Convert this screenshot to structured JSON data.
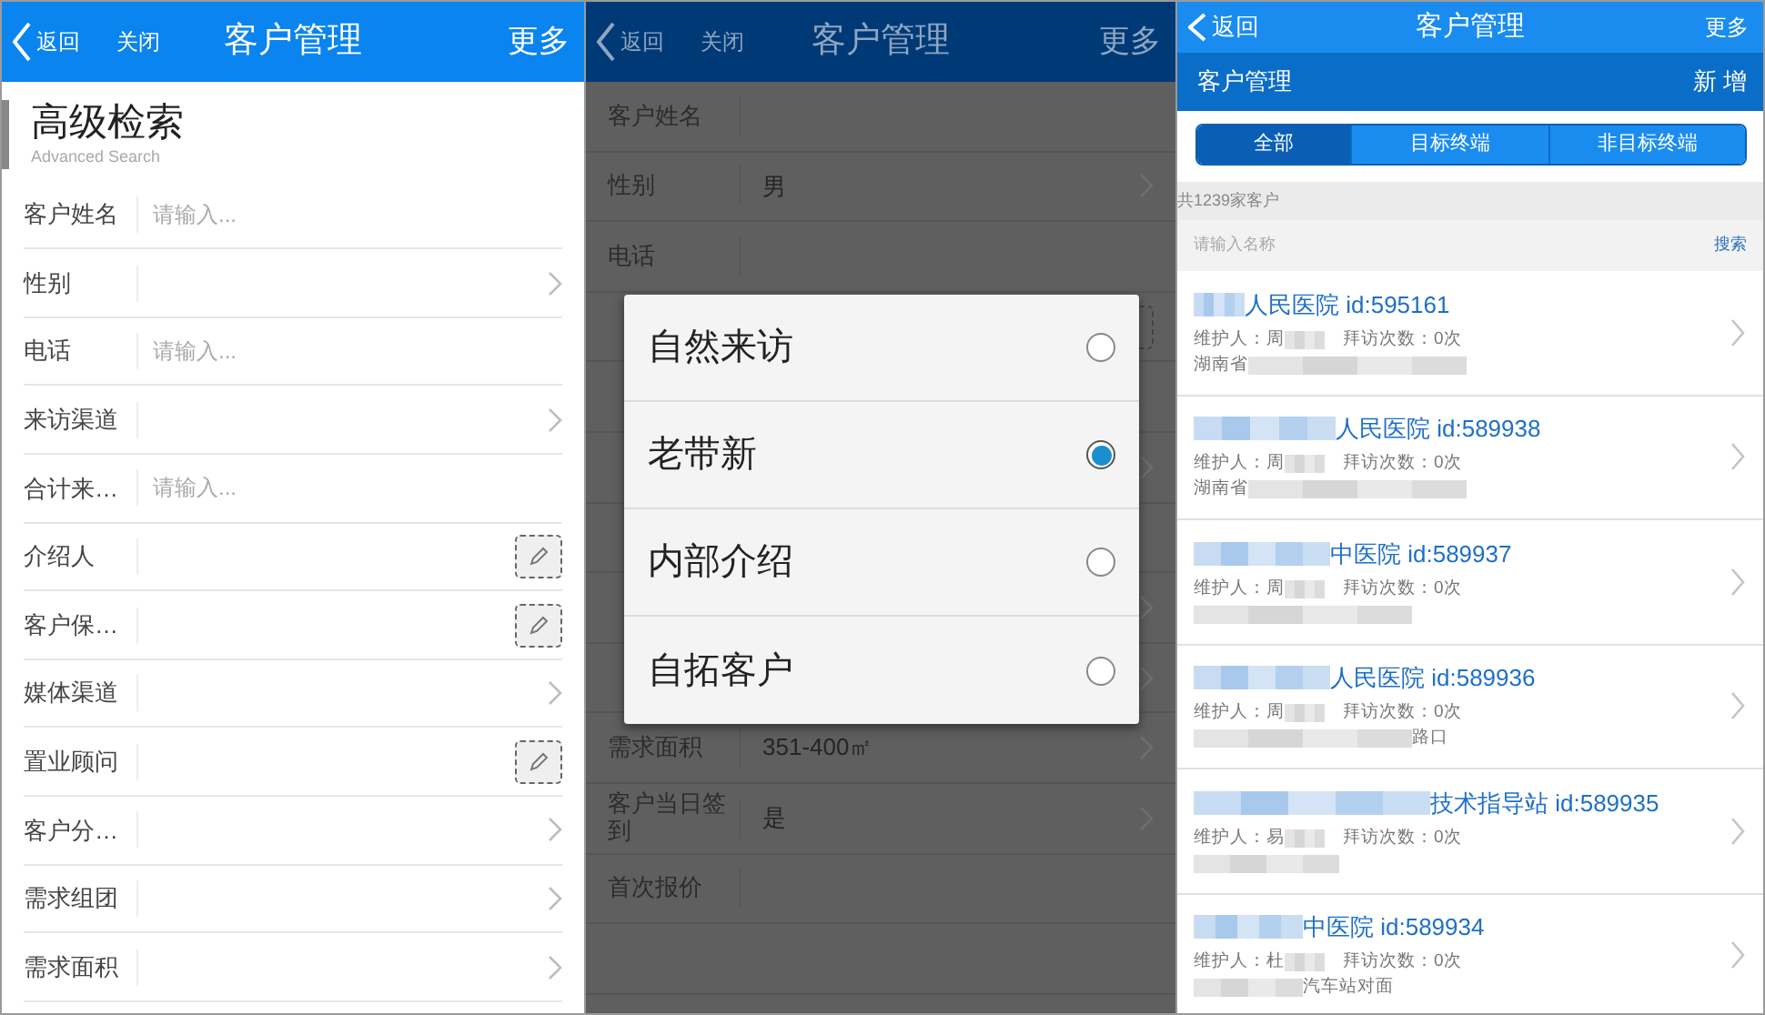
{
  "screens": [
    {
      "kind": "search_form",
      "header": {
        "back": "返回",
        "close": "关闭",
        "title": "客户管理",
        "more": "更多"
      },
      "heading": "高级检索",
      "subheading": "Advanced Search",
      "fields": [
        {
          "label": "客户姓名",
          "kind": "input",
          "placeholder": "请输入..."
        },
        {
          "label": "性别",
          "kind": "select"
        },
        {
          "label": "电话",
          "kind": "input",
          "placeholder": "请输入..."
        },
        {
          "label": "来访渠道",
          "kind": "select"
        },
        {
          "label": "合计来…",
          "kind": "input",
          "placeholder": "请输入..."
        },
        {
          "label": "介绍人",
          "kind": "pick"
        },
        {
          "label": "客户保…",
          "kind": "pick"
        },
        {
          "label": "媒体渠道",
          "kind": "select"
        },
        {
          "label": "置业顾问",
          "kind": "pick"
        },
        {
          "label": "客户分…",
          "kind": "select"
        },
        {
          "label": "需求组团",
          "kind": "select"
        },
        {
          "label": "需求面积",
          "kind": "select"
        }
      ]
    },
    {
      "kind": "form_with_dialog",
      "header": {
        "back": "返回",
        "close": "关闭",
        "title": "客户管理",
        "more": "更多"
      },
      "fields": [
        {
          "label": "客户姓名",
          "kind": "text"
        },
        {
          "label": "性别",
          "kind": "select",
          "value": "男"
        },
        {
          "label": "电话",
          "kind": "text"
        },
        {
          "kind": "pick"
        },
        {
          "kind": "text"
        },
        {
          "kind": "select"
        },
        {
          "kind": "text"
        },
        {
          "kind": "select"
        },
        {
          "kind": "select"
        },
        {
          "label": "需求面积",
          "kind": "select",
          "value": "351-400㎡"
        },
        {
          "label": "客户当日签到",
          "kind": "select",
          "value": "是"
        },
        {
          "label": "首次报价",
          "kind": "text"
        },
        {
          "kind": "empty"
        }
      ],
      "dialog": {
        "options": [
          {
            "label": "自然来访",
            "selected": false
          },
          {
            "label": "老带新",
            "selected": true
          },
          {
            "label": "内部介绍",
            "selected": false
          },
          {
            "label": "自拓客户",
            "selected": false
          }
        ]
      }
    },
    {
      "kind": "customer_list",
      "header": {
        "back": "返回",
        "title": "客户管理",
        "more": "更多"
      },
      "subheader": {
        "title": "客户管理",
        "action": "新 增"
      },
      "segments": [
        {
          "label": "全部",
          "selected": true
        },
        {
          "label": "目标终端",
          "selected": false
        },
        {
          "label": "非目标终端",
          "selected": false
        }
      ],
      "count": "共1239家客户",
      "search": {
        "placeholder": "请输入名称",
        "button": "搜索"
      },
      "items": [
        {
          "name_blurred": true,
          "name": "人民医院 id:595161",
          "maintainer": "维护人：周",
          "maintainer_blurred": true,
          "visits": "拜访次数：0次",
          "address_parts": [
            {
              "kind": "text",
              "text": "湖南省"
            },
            {
              "kind": "blur"
            }
          ]
        },
        {
          "name_blurred": true,
          "name": "人民医院 id:589938",
          "maintainer": "维护人：周",
          "maintainer_blurred": true,
          "visits": "拜访次数：0次",
          "address_parts": [
            {
              "kind": "text",
              "text": "湖南省"
            },
            {
              "kind": "blur"
            }
          ]
        },
        {
          "name_blurred": true,
          "name": "中医院 id:589937",
          "maintainer": "维护人：周",
          "maintainer_blurred": true,
          "visits": "拜访次数：0次",
          "address_parts": [
            {
              "kind": "blur"
            }
          ]
        },
        {
          "name_blurred": true,
          "name": "人民医院 id:589936",
          "maintainer": "维护人：周",
          "maintainer_blurred": true,
          "visits": "拜访次数：0次",
          "address_parts": [
            {
              "kind": "blur"
            },
            {
              "kind": "text",
              "text": "路口"
            }
          ]
        },
        {
          "name_blurred": true,
          "name": "技术指导站 id:589935",
          "maintainer": "维护人：易",
          "maintainer_blurred": true,
          "visits": "拜访次数：0次",
          "address_parts": [
            {
              "kind": "blur"
            }
          ]
        },
        {
          "name_blurred": true,
          "name": "中医院 id:589934",
          "maintainer": "维护人：杜",
          "maintainer_blurred": true,
          "visits": "拜访次数：0次",
          "address_parts": [
            {
              "kind": "blur"
            },
            {
              "kind": "text",
              "text": "汽车站对面"
            }
          ]
        }
      ]
    }
  ]
}
